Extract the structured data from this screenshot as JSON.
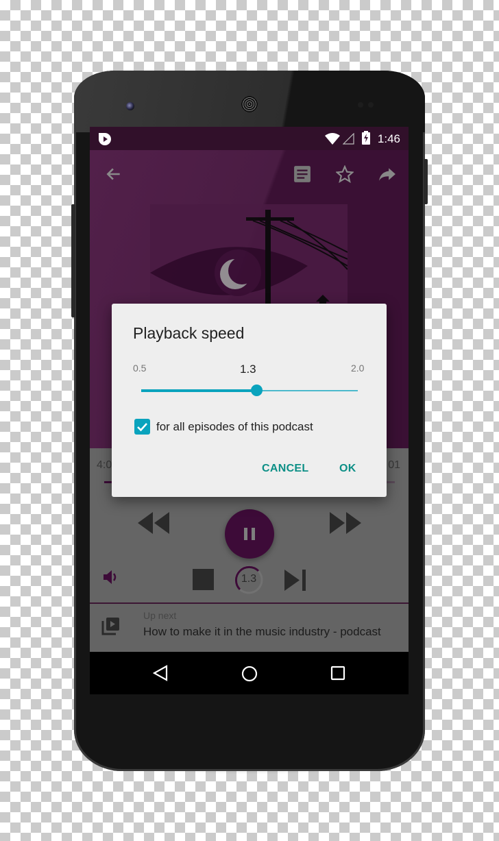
{
  "status_bar": {
    "app_icon": "pocket-casts-play-icon",
    "wifi_icon": "wifi-icon",
    "signal_icon": "cell-signal-icon",
    "battery_icon": "battery-charging-icon",
    "time": "1:46"
  },
  "app_bar": {
    "back_icon": "arrow-left-icon",
    "notes_icon": "show-notes-icon",
    "star_icon": "star-outline-icon",
    "share_icon": "share-icon"
  },
  "artwork": {
    "description": "podcast artwork: eye with crescent moon, telephone pole"
  },
  "player": {
    "elapsed_partial": "4:0",
    "remaining_partial": "01",
    "controls": {
      "rewind_icon": "rewind-icon",
      "play_pause_icon": "pause-icon",
      "fast_forward_icon": "fast-forward-icon",
      "volume_icon": "volume-up-icon",
      "stop_icon": "stop-icon",
      "speed_value": "1.3",
      "skip_next_icon": "skip-next-icon"
    },
    "accent_color": "#4a0e44"
  },
  "up_next": {
    "icon": "playlist-play-icon",
    "label": "Up next",
    "title": "How to make it in the music industry - podcast"
  },
  "nav_bar": {
    "back_icon": "nav-back-icon",
    "home_icon": "nav-home-icon",
    "recents_icon": "nav-recents-icon"
  },
  "dialog": {
    "title": "Playback speed",
    "min_label": "0.5",
    "max_label": "2.0",
    "current_value": "1.3",
    "slider": {
      "min": 0.5,
      "max": 2.0,
      "value": 1.3
    },
    "checkbox_label": "for all episodes of this podcast",
    "checkbox_checked": true,
    "cancel_label": "CANCEL",
    "ok_label": "OK",
    "accent_color": "#0aa3bd",
    "button_color": "#0c8f86"
  }
}
